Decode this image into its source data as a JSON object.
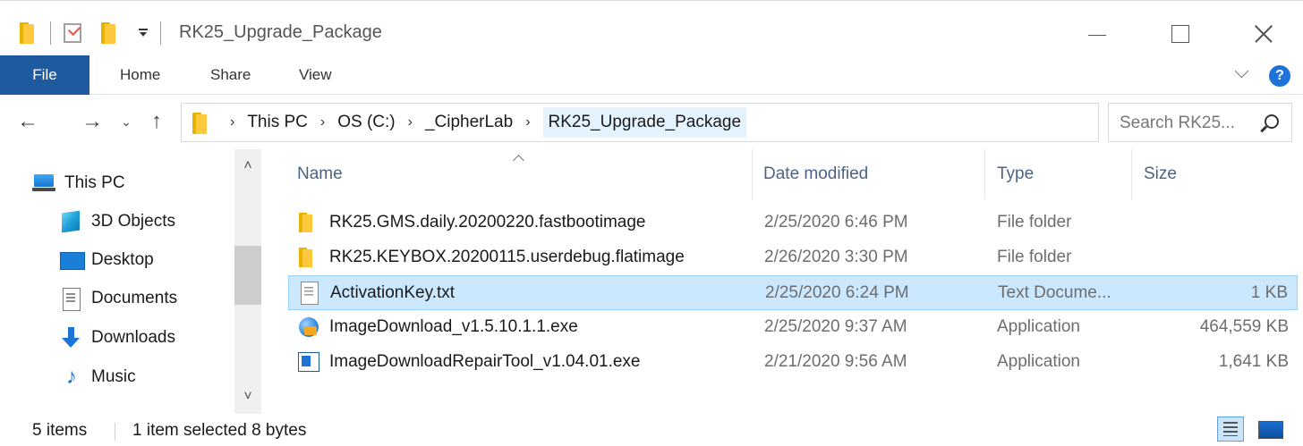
{
  "window": {
    "title": "RK25_Upgrade_Package"
  },
  "ribbon": {
    "tabs": [
      "File",
      "Home",
      "Share",
      "View"
    ],
    "help_label": "?"
  },
  "navigation": {
    "back_icon": "←",
    "forward_icon": "→",
    "recent_icon": "⌄",
    "up_icon": "↑",
    "breadcrumbs": [
      "This PC",
      "OS (C:)",
      "_CipherLab",
      "RK25_Upgrade_Package"
    ],
    "crumb_separator": "›",
    "refresh_icon": "↻",
    "search_placeholder": "Search RK25..."
  },
  "sidebar": {
    "items": [
      {
        "label": "This PC",
        "icon": "pc-icon"
      },
      {
        "label": "3D Objects",
        "icon": "3d-objects-icon"
      },
      {
        "label": "Desktop",
        "icon": "desktop-icon"
      },
      {
        "label": "Documents",
        "icon": "documents-icon"
      },
      {
        "label": "Downloads",
        "icon": "downloads-icon"
      },
      {
        "label": "Music",
        "icon": "music-icon"
      }
    ],
    "music_glyph": "♪",
    "scroll_up": "˄",
    "scroll_down": "˅"
  },
  "columns": {
    "name": "Name",
    "date": "Date modified",
    "type": "Type",
    "size": "Size"
  },
  "files": [
    {
      "name": "RK25.GMS.daily.20200220.fastbootimage",
      "date": "2/25/2020 6:46 PM",
      "type": "File folder",
      "size": "",
      "icon": "folder-icon"
    },
    {
      "name": "RK25.KEYBOX.20200115.userdebug.flatimage",
      "date": "2/26/2020 3:30 PM",
      "type": "File folder",
      "size": "",
      "icon": "folder-icon"
    },
    {
      "name": "ActivationKey.txt",
      "date": "2/25/2020 6:24 PM",
      "type": "Text Docume...",
      "size": "1 KB",
      "icon": "text-file-icon",
      "selected": true
    },
    {
      "name": "ImageDownload_v1.5.10.1.1.exe",
      "date": "2/25/2020 9:37 AM",
      "type": "Application",
      "size": "464,559 KB",
      "icon": "app-icon"
    },
    {
      "name": "ImageDownloadRepairTool_v1.04.01.exe",
      "date": "2/21/2020 9:56 AM",
      "type": "Application",
      "size": "1,641 KB",
      "icon": "app-icon"
    }
  ],
  "status": {
    "item_count": "5 items",
    "selection": "1 item selected  8 bytes"
  },
  "colors": {
    "accent": "#1e5aa0",
    "selection": "#cce8ff"
  }
}
